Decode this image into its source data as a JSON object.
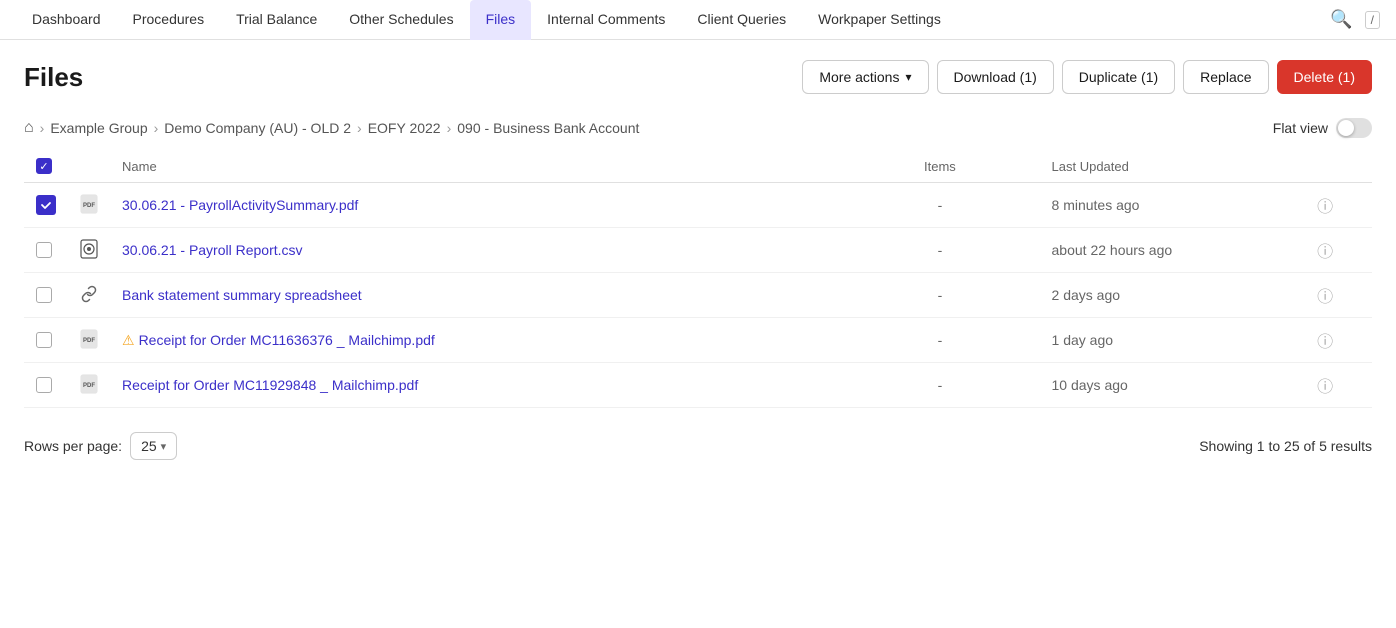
{
  "nav": {
    "items": [
      {
        "id": "dashboard",
        "label": "Dashboard",
        "active": false
      },
      {
        "id": "procedures",
        "label": "Procedures",
        "active": false
      },
      {
        "id": "trial-balance",
        "label": "Trial Balance",
        "active": false
      },
      {
        "id": "other-schedules",
        "label": "Other Schedules",
        "active": false
      },
      {
        "id": "files",
        "label": "Files",
        "active": true
      },
      {
        "id": "internal-comments",
        "label": "Internal Comments",
        "active": false
      },
      {
        "id": "client-queries",
        "label": "Client Queries",
        "active": false
      },
      {
        "id": "workpaper-settings",
        "label": "Workpaper Settings",
        "active": false
      }
    ]
  },
  "header": {
    "title": "Files",
    "actions": {
      "more_actions": "More actions",
      "download": "Download (1)",
      "duplicate": "Duplicate (1)",
      "replace": "Replace",
      "delete": "Delete (1)"
    }
  },
  "breadcrumb": {
    "home_icon": "🏠",
    "items": [
      {
        "label": "Example Group"
      },
      {
        "label": "Demo Company (AU) - OLD 2"
      },
      {
        "label": "EOFY 2022"
      },
      {
        "label": "090 - Business Bank Account"
      }
    ],
    "flat_view_label": "Flat view"
  },
  "table": {
    "columns": {
      "name": "Name",
      "items": "Items",
      "last_updated": "Last Updated",
      "info": ""
    },
    "rows": [
      {
        "id": 1,
        "checked": true,
        "icon_type": "pdf",
        "name": "30.06.21 - PayrollActivitySummary.pdf",
        "items": "-",
        "last_updated": "8 minutes ago",
        "has_warning": false
      },
      {
        "id": 2,
        "checked": false,
        "icon_type": "csv",
        "name": "30.06.21 - Payroll Report.csv",
        "items": "-",
        "last_updated": "about 22 hours ago",
        "has_warning": false
      },
      {
        "id": 3,
        "checked": false,
        "icon_type": "link",
        "name": "Bank statement summary spreadsheet",
        "items": "-",
        "last_updated": "2 days ago",
        "has_warning": false
      },
      {
        "id": 4,
        "checked": false,
        "icon_type": "pdf",
        "name": "Receipt for Order MC11636376 _ Mailchimp.pdf",
        "items": "-",
        "last_updated": "1 day ago",
        "has_warning": true
      },
      {
        "id": 5,
        "checked": false,
        "icon_type": "pdf",
        "name": "Receipt for Order MC11929848 _ Mailchimp.pdf",
        "items": "-",
        "last_updated": "10 days ago",
        "has_warning": false
      }
    ]
  },
  "pagination": {
    "rows_per_page_label": "Rows per page:",
    "rows_per_page_value": "25",
    "showing_text": "Showing 1 to 25 of 5 results"
  },
  "icons": {
    "pdf": "📄",
    "csv": "🔍",
    "link": "🔗",
    "info": "ℹ",
    "warning": "⚠",
    "home": "⌂",
    "chevron_right": "›",
    "chevron_down": "⌄",
    "search": "🔍"
  }
}
